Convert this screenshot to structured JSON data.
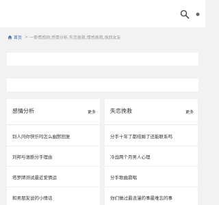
{
  "icons": {
    "search": "search-icon",
    "dot": "dot-icon",
    "home": "home-icon"
  },
  "colors": {
    "link": "#3b6fb6",
    "page_bg": "#f2f2f2"
  },
  "breadcrumb": {
    "home": "首页",
    "sep": ">",
    "path": "一拳情感网,感情分析,失恋挽救,情感挽救,挽回女友"
  },
  "left_card": {
    "title": "感情分析",
    "more": "更多",
    "items": [
      {
        "text": "别人问你快乐吗怎么幽默回复"
      },
      {
        "text": "刘邦与谁断分手理由"
      },
      {
        "text": "塔罗牌测试最近爱情运"
      },
      {
        "text": "和男朋友说的小情话"
      }
    ]
  },
  "right_card": {
    "title": "失恋挽救",
    "more": "更多",
    "items": [
      {
        "text": "分手十年了都结婚了还能联系吗"
      },
      {
        "text": "冷战两个月男人心理"
      },
      {
        "text": "分手歌曲鼎唱"
      },
      {
        "text": "你们做过最浪漫的事最难忘的事"
      }
    ]
  }
}
